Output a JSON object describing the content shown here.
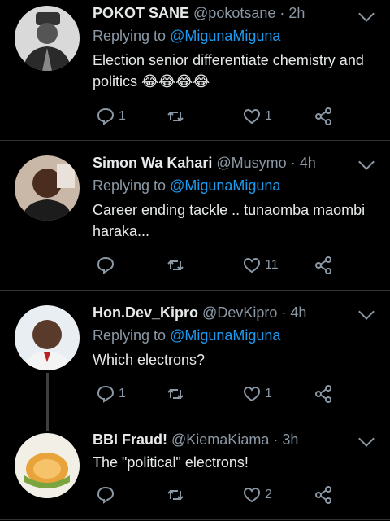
{
  "tweets": [
    {
      "name": "POKOT SANE",
      "handle": "@pokotsane",
      "time": "2h",
      "reply_prefix": "Replying to",
      "mention": "@MigunaMiguna",
      "text": "Election senior differentiate chemistry and politics 😂😂😂😂",
      "replies": "1",
      "retweets": "",
      "likes": "1"
    },
    {
      "name": "Simon Wa Kahari",
      "handle": "@Musymo",
      "time": "4h",
      "reply_prefix": "Replying to",
      "mention": "@MigunaMiguna",
      "text": "Career ending tackle .. tunaomba maombi haraka...",
      "replies": "",
      "retweets": "",
      "likes": "11"
    },
    {
      "name": "Hon.Dev_Kipro",
      "handle": "@DevKipro",
      "time": "4h",
      "reply_prefix": "Replying to",
      "mention": "@MigunaMiguna",
      "text": "Which electrons?",
      "replies": "1",
      "retweets": "",
      "likes": "1"
    },
    {
      "name": "BBI Fraud!",
      "handle": "@KiemaKiama",
      "time": "3h",
      "text": "The \"political\" electrons!",
      "replies": "",
      "retweets": "",
      "likes": "2"
    }
  ],
  "colors": {
    "background": "#000000",
    "text": "#e7e9ea",
    "muted": "#8b98a5",
    "mention": "#1d9bf0",
    "divider": "#2f3336"
  },
  "icons": [
    "reply-icon",
    "retweet-icon",
    "like-icon",
    "share-icon",
    "chevron-down-icon"
  ]
}
